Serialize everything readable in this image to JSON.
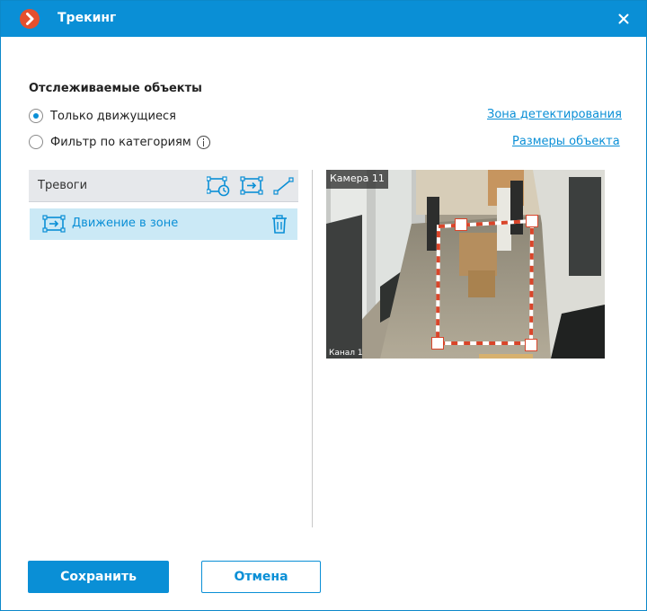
{
  "window": {
    "title": "Трекинг"
  },
  "tracked_objects": {
    "section_title": "Отслеживаемые объекты",
    "options": [
      {
        "label": "Только движущиеся",
        "checked": true
      },
      {
        "label": "Фильтр по категориям",
        "checked": false
      }
    ],
    "links": {
      "detection_zone": "Зона детектирования",
      "object_sizes": "Размеры объекта"
    }
  },
  "alarms": {
    "title": "Тревоги",
    "tools": [
      "zone-timer-icon",
      "zone-enter-icon",
      "line-cross-icon"
    ],
    "items": [
      {
        "label": "Движение в зоне",
        "icon": "zone-enter-icon"
      }
    ]
  },
  "camera": {
    "name": "Камера 11",
    "channel": "Канал 1"
  },
  "buttons": {
    "save": "Сохранить",
    "cancel": "Отмена"
  },
  "colors": {
    "accent": "#0a8fd6",
    "logo": "#e5502e",
    "selected_item_bg": "#cbe9f6",
    "zone_line": "#d9452a"
  }
}
